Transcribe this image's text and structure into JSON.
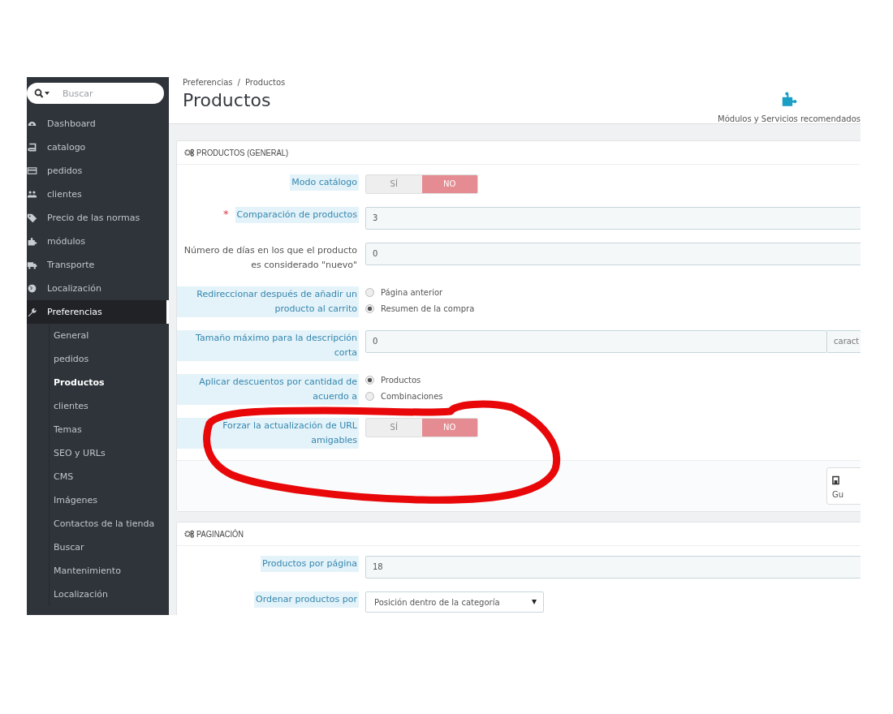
{
  "sidebar": {
    "search": {
      "placeholder": "Buscar"
    },
    "items": [
      {
        "label": "Dashboard",
        "selected": false
      },
      {
        "label": "catalogo",
        "selected": false
      },
      {
        "label": "pedidos",
        "selected": false
      },
      {
        "label": "clientes",
        "selected": false
      },
      {
        "label": "Precio de las normas",
        "selected": false
      },
      {
        "label": "módulos",
        "selected": false
      },
      {
        "label": "Transporte",
        "selected": false
      },
      {
        "label": "Localización",
        "selected": false
      },
      {
        "label": "Preferencias",
        "selected": true,
        "children": [
          {
            "label": "General",
            "selected": false
          },
          {
            "label": "pedidos",
            "selected": false
          },
          {
            "label": "Productos",
            "selected": true
          },
          {
            "label": "clientes",
            "selected": false
          },
          {
            "label": "Temas",
            "selected": false
          },
          {
            "label": "SEO y URLs",
            "selected": false
          },
          {
            "label": "CMS",
            "selected": false
          },
          {
            "label": "Imágenes",
            "selected": false
          },
          {
            "label": "Contactos de la tienda",
            "selected": false
          },
          {
            "label": "Buscar",
            "selected": false
          },
          {
            "label": "Mantenimiento",
            "selected": false
          },
          {
            "label": "Localización",
            "selected": false
          }
        ]
      }
    ]
  },
  "header": {
    "breadcrumb": [
      "Preferencias",
      "Productos"
    ],
    "breadcrumb_separator": "/",
    "title": "Productos",
    "toolbar_button": "Módulos y Servicios recomendados"
  },
  "panels": [
    {
      "title": "PRODUCTOS (GENERAL)",
      "rows": [
        {
          "kind": "toggle",
          "label": "Modo catálogo",
          "hint": true,
          "options": [
            {
              "label": "SÍ",
              "selected": false
            },
            {
              "label": "NO",
              "selected": true
            }
          ]
        },
        {
          "kind": "text",
          "label": "Comparación de productos",
          "hint": true,
          "required_mark": "*",
          "value": "3"
        },
        {
          "kind": "text",
          "label": "Número de días en los que el producto es considerado \"nuevo\"",
          "hint": false,
          "value": "0"
        },
        {
          "kind": "radio",
          "label": "Redireccionar después de añadir un producto al carrito",
          "hint": true,
          "options": [
            {
              "label": "Página anterior",
              "selected": false
            },
            {
              "label": "Resumen de la compra",
              "selected": true
            }
          ]
        },
        {
          "kind": "text",
          "label": "Tamaño máximo para la descripción corta",
          "hint": true,
          "value": "0",
          "suffix": "caract"
        },
        {
          "kind": "radio",
          "label": "Aplicar descuentos por cantidad de acuerdo a",
          "hint": true,
          "options": [
            {
              "label": "Productos",
              "selected": true
            },
            {
              "label": "Combinaciones",
              "selected": false
            }
          ]
        },
        {
          "kind": "toggle",
          "label": "Forzar la actualización de URL amigables",
          "hint": true,
          "options": [
            {
              "label": "SÍ",
              "selected": false
            },
            {
              "label": "NO",
              "selected": true
            }
          ]
        }
      ],
      "footer_button": "Gu"
    },
    {
      "title": "PAGINACIÓN",
      "rows": [
        {
          "kind": "text",
          "label": "Productos por página",
          "hint": true,
          "value": "18"
        },
        {
          "kind": "select",
          "label": "Ordenar productos por",
          "hint": true,
          "value": "Posición dentro de la categoría"
        }
      ]
    }
  ]
}
